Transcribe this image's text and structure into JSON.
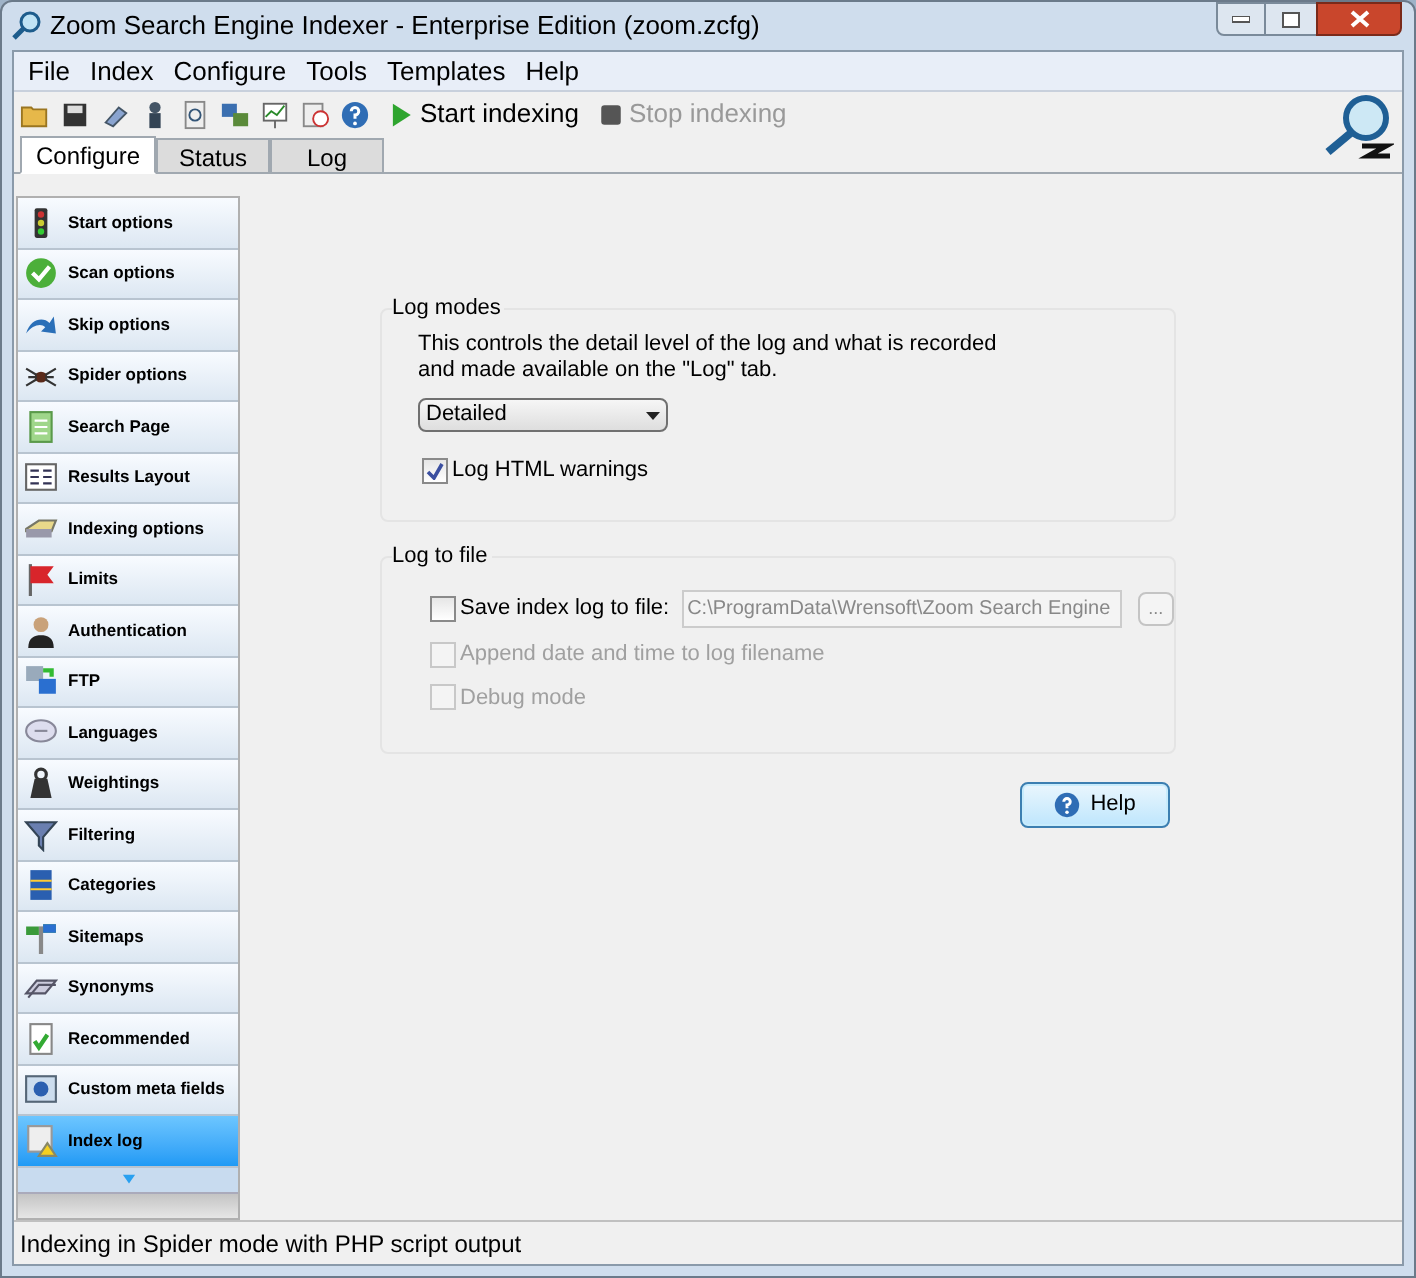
{
  "window": {
    "title": "Zoom Search Engine Indexer - Enterprise Edition (zoom.zcfg)"
  },
  "menu": [
    "File",
    "Index",
    "Configure",
    "Tools",
    "Templates",
    "Help"
  ],
  "toolbar": {
    "actions": [
      {
        "label": "Start indexing",
        "disabled": false
      },
      {
        "label": "Stop indexing",
        "disabled": true
      }
    ]
  },
  "tabs": [
    {
      "label": "Configure",
      "selected": true
    },
    {
      "label": "Status",
      "selected": false
    },
    {
      "label": "Log",
      "selected": false
    }
  ],
  "sidebar": {
    "items": [
      {
        "label": "Start options",
        "selected": false
      },
      {
        "label": "Scan options",
        "selected": false
      },
      {
        "label": "Skip options",
        "selected": false
      },
      {
        "label": "Spider options",
        "selected": false
      },
      {
        "label": "Search Page",
        "selected": false
      },
      {
        "label": "Results Layout",
        "selected": false
      },
      {
        "label": "Indexing options",
        "selected": false
      },
      {
        "label": "Limits",
        "selected": false
      },
      {
        "label": "Authentication",
        "selected": false
      },
      {
        "label": "FTP",
        "selected": false
      },
      {
        "label": "Languages",
        "selected": false
      },
      {
        "label": "Weightings",
        "selected": false
      },
      {
        "label": "Filtering",
        "selected": false
      },
      {
        "label": "Categories",
        "selected": false
      },
      {
        "label": "Sitemaps",
        "selected": false
      },
      {
        "label": "Synonyms",
        "selected": false
      },
      {
        "label": "Recommended",
        "selected": false
      },
      {
        "label": "Custom meta fields",
        "selected": false
      },
      {
        "label": "Index log",
        "selected": true
      }
    ]
  },
  "log_modes": {
    "title": "Log modes",
    "description": "This controls the detail level of the log and what is recorded and made available on the \"Log\" tab.",
    "dropdown": {
      "value": "Detailed"
    },
    "checkbox": {
      "label": "Log HTML warnings",
      "checked": true
    }
  },
  "log_to_file": {
    "title": "Log to file",
    "options": [
      {
        "label": "Save index log to file:",
        "checked": false,
        "disabled": false
      },
      {
        "label": "Append date and time to log filename",
        "checked": false,
        "disabled": true
      },
      {
        "label": "Debug mode",
        "checked": false,
        "disabled": true
      }
    ],
    "path_field": {
      "value": "C:\\ProgramData\\Wrensoft\\Zoom Search Engine",
      "disabled": true
    },
    "browse_button": "..."
  },
  "help_button": "Help",
  "status_bar": "Indexing in Spider mode with PHP script output"
}
